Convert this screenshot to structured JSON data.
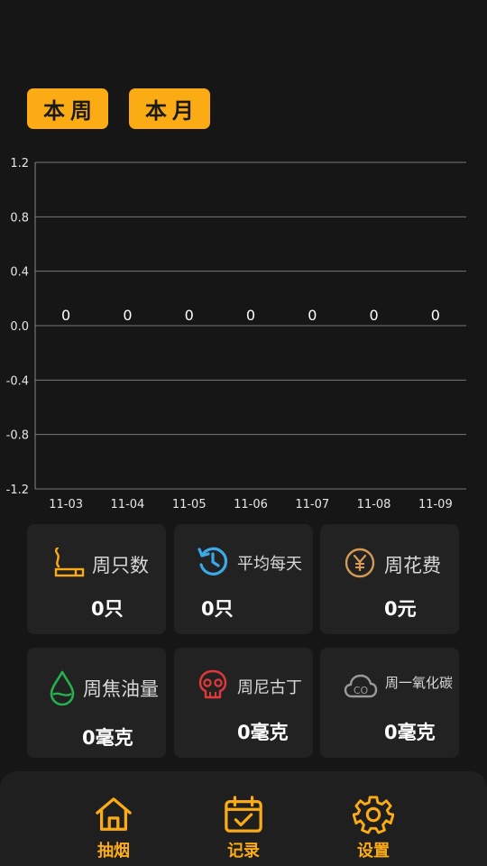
{
  "period_tabs": {
    "week": "本周",
    "month": "本月"
  },
  "chart_data": {
    "type": "line",
    "categories": [
      "11-03",
      "11-04",
      "11-05",
      "11-06",
      "11-07",
      "11-08",
      "11-09"
    ],
    "values": [
      0,
      0,
      0,
      0,
      0,
      0,
      0
    ],
    "data_labels": [
      "0",
      "0",
      "0",
      "0",
      "0",
      "0",
      "0"
    ],
    "y_ticks": [
      "1.2",
      "0.8",
      "0.4",
      "0.0",
      "-0.4",
      "-0.8",
      "-1.2"
    ],
    "ylim": [
      -1.2,
      1.2
    ],
    "grid": true
  },
  "stats": {
    "weekly_count": {
      "label": "周只数",
      "value": "0只",
      "icon": "cigarette-icon",
      "color": "#fbac14"
    },
    "daily_average": {
      "label": "平均每天",
      "value": "0只",
      "icon": "history-icon",
      "color": "#3ba8e8"
    },
    "weekly_cost": {
      "label": "周花费",
      "value": "0元",
      "icon": "yen-coin-icon",
      "color": "#d69a55"
    },
    "weekly_tar": {
      "label": "周焦油量",
      "value": "0毫克",
      "icon": "water-drop-icon",
      "color": "#27b04e"
    },
    "weekly_nicotine": {
      "label": "周尼古丁",
      "value": "0毫克",
      "icon": "skull-icon",
      "color": "#e0393b"
    },
    "weekly_co": {
      "label": "周一氧化碳",
      "value": "0毫克",
      "icon": "co-cloud-icon",
      "color": "#9a9a9a"
    }
  },
  "nav": {
    "smoke": "抽烟",
    "records": "记录",
    "settings": "设置",
    "accent": "#fbac14"
  }
}
